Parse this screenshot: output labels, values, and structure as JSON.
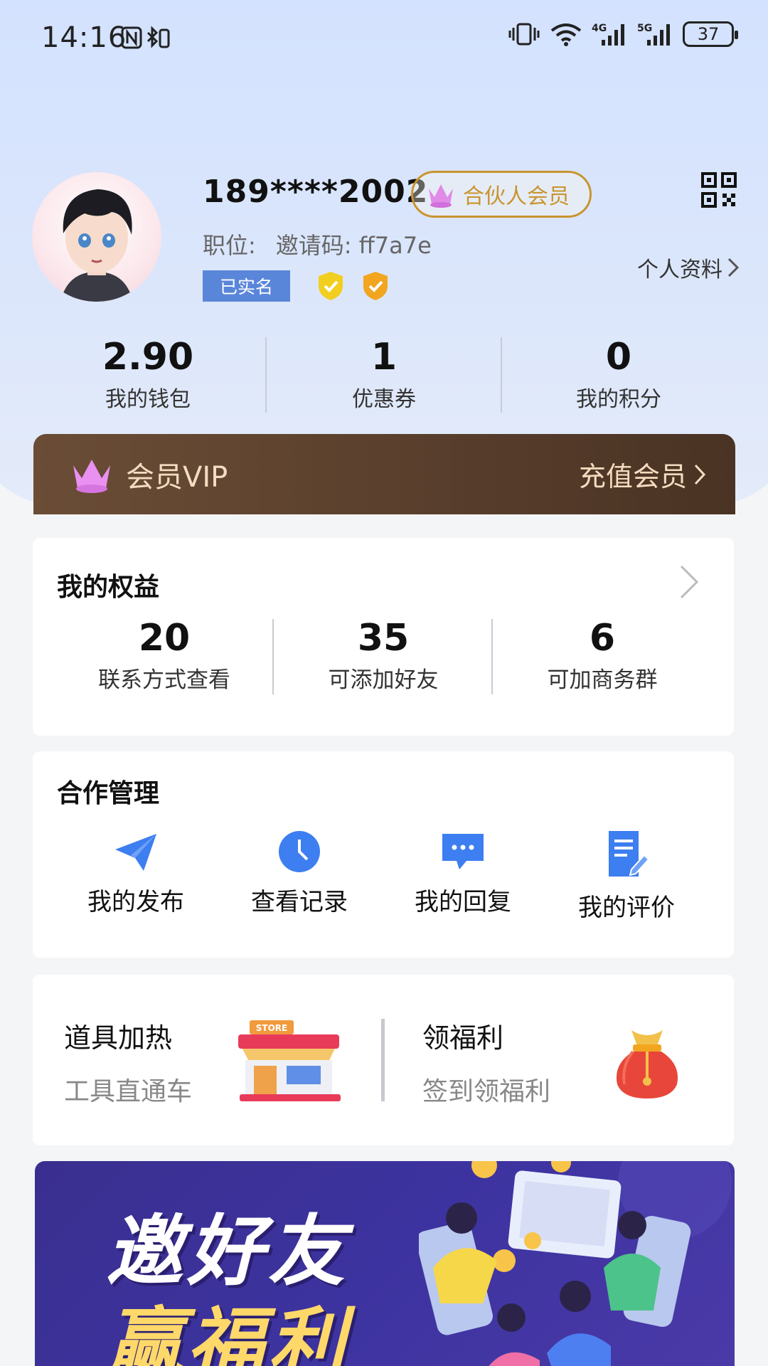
{
  "status_bar": {
    "time": "14:16",
    "battery": "37"
  },
  "profile": {
    "phone": "189****2002",
    "member_badge": "合伙人会员",
    "position_label": "职位:",
    "invite_code": "邀请码: ff7a7e",
    "profile_link": "个人资料",
    "verified_label": "已实名"
  },
  "stats": [
    {
      "value": "2.90",
      "label": "我的钱包"
    },
    {
      "value": "1",
      "label": "优惠券"
    },
    {
      "value": "0",
      "label": "我的积分"
    }
  ],
  "vip": {
    "title": "会员VIP",
    "action": "充值会员"
  },
  "rights": {
    "title": "我的权益",
    "items": [
      {
        "value": "20",
        "label": "联系方式查看"
      },
      {
        "value": "35",
        "label": "可添加好友"
      },
      {
        "value": "6",
        "label": "可加商务群"
      }
    ]
  },
  "management": {
    "title": "合作管理",
    "items": [
      {
        "label": "我的发布",
        "icon": "paper-plane-icon"
      },
      {
        "label": "查看记录",
        "icon": "clock-icon"
      },
      {
        "label": "我的回复",
        "icon": "chat-bubble-icon"
      },
      {
        "label": "我的评价",
        "icon": "document-edit-icon"
      }
    ]
  },
  "promos": [
    {
      "title": "道具加热",
      "subtitle": "工具直通车",
      "icon": "store-icon"
    },
    {
      "title": "领福利",
      "subtitle": "签到领福利",
      "icon": "lucky-bag-icon"
    }
  ],
  "banner": {
    "line1": "邀好友",
    "line2": "赢福利"
  },
  "colors": {
    "accent_blue": "#3d7ef0",
    "gold": "#c9952e",
    "vip_brown": "#5a3f2c"
  }
}
